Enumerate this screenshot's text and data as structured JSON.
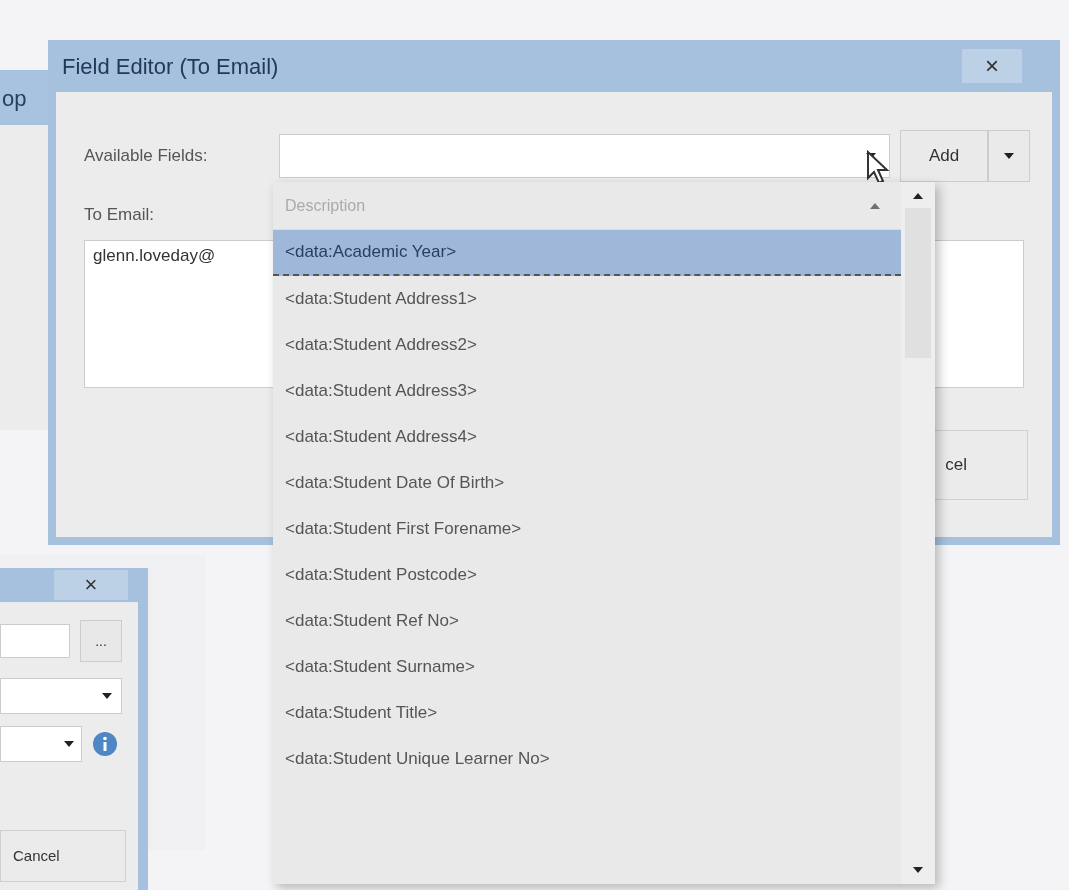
{
  "back_window": {
    "title": "op"
  },
  "field_editor": {
    "title": "Field Editor (To Email)",
    "close": "×",
    "available_fields_label": "Available Fields:",
    "add_button": "Add",
    "to_email_label": "To Email:",
    "to_email_value": "glenn.loveday@",
    "bottom_button": "cel"
  },
  "dropdown": {
    "header": "Description",
    "items": [
      {
        "label": "<data:Academic Year>",
        "selected": true
      },
      {
        "label": "<data:Student Address1>",
        "selected": false
      },
      {
        "label": "<data:Student Address2>",
        "selected": false
      },
      {
        "label": "<data:Student Address3>",
        "selected": false
      },
      {
        "label": "<data:Student Address4>",
        "selected": false
      },
      {
        "label": "<data:Student Date Of Birth>",
        "selected": false
      },
      {
        "label": "<data:Student First Forename>",
        "selected": false
      },
      {
        "label": "<data:Student Postcode>",
        "selected": false
      },
      {
        "label": "<data:Student Ref No>",
        "selected": false
      },
      {
        "label": "<data:Student Surname>",
        "selected": false
      },
      {
        "label": "<data:Student Title>",
        "selected": false
      },
      {
        "label": "<data:Student Unique Learner No>",
        "selected": false
      }
    ]
  },
  "small_dialog": {
    "close": "×",
    "browse_button": "...",
    "cancel_button": "Cancel"
  }
}
